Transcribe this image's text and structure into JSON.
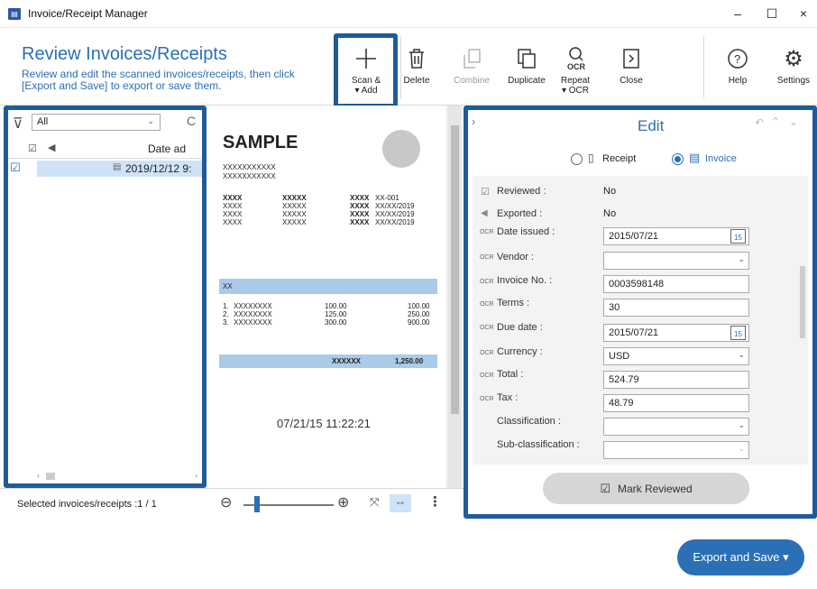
{
  "app": {
    "title": "Invoice/Receipt Manager"
  },
  "window": {
    "minimize": "–",
    "maximize": "☐",
    "close": "×"
  },
  "header": {
    "title": "Review Invoices/Receipts",
    "description": "Review and edit the scanned invoices/receipts, then click [Export and Save] to export or save them."
  },
  "toolbar": {
    "scan_add": "Scan & ▾ Add",
    "delete": "Delete",
    "combine": "Combine",
    "duplicate": "Duplicate",
    "repeat_ocr": "Repeat ▾ OCR",
    "close": "Close",
    "help": "Help",
    "settings": "Settings"
  },
  "list": {
    "filter_value": "All",
    "col_date": "Date ad",
    "rows": [
      {
        "date": "2019/12/12 9:"
      }
    ]
  },
  "status": {
    "selected": "Selected invoices/receipts :1 / 1"
  },
  "document": {
    "heading": "SAMPLE",
    "line1": "XXXXXXXXXXX",
    "line2": "XXXXXXXXXXX",
    "grid": [
      [
        "XXXX",
        "XXXXX",
        "XXXX",
        "XX-001"
      ],
      [
        "XXXX",
        "XXXXX",
        "XXXX",
        "XX/XX/2019"
      ],
      [
        "XXXX",
        "XXXXX",
        "XXXX",
        "XX/XX/2019"
      ],
      [
        "XXXX",
        "XXXXX",
        "XXXX",
        "XX/XX/2019"
      ]
    ],
    "band": "XX",
    "items": [
      [
        "1.",
        "XXXXXXXX",
        "100.00",
        "100.00"
      ],
      [
        "2.",
        "XXXXXXXX",
        "125.00",
        "250.00"
      ],
      [
        "3.",
        "XXXXXXXX",
        "300.00",
        "900.00"
      ]
    ],
    "total_label": "XXXXXX",
    "total_value": "1,250.00",
    "timestamp": "07/21/15  11:22:21"
  },
  "edit": {
    "title": "Edit",
    "type_receipt": "Receipt",
    "type_invoice": "Invoice",
    "fields": {
      "reviewed": {
        "label": "Reviewed :",
        "value": "No"
      },
      "exported": {
        "label": "Exported :",
        "value": "No"
      },
      "date_issued": {
        "label": "Date issued :",
        "value": "2015/07/21"
      },
      "vendor": {
        "label": "Vendor :",
        "value": ""
      },
      "invoice_no": {
        "label": "Invoice No. :",
        "value": "0003598148"
      },
      "terms": {
        "label": "Terms :",
        "value": "30"
      },
      "due_date": {
        "label": "Due date :",
        "value": "2015/07/21"
      },
      "currency": {
        "label": "Currency :",
        "value": "USD"
      },
      "total": {
        "label": "Total :",
        "value": "524.79"
      },
      "tax": {
        "label": "Tax :",
        "value": "48.79"
      },
      "classification": {
        "label": "Classification :",
        "value": ""
      },
      "sub_classification": {
        "label": "Sub-classification :",
        "value": ""
      }
    },
    "calendar_day": "15",
    "ocr_tag": "OCR",
    "mark_reviewed": "Mark Reviewed"
  },
  "export_button": "Export and Save  ▾",
  "colors": {
    "accent": "#2b6fb5",
    "highlight": "#1f5b99",
    "band": "#a9cbe8"
  }
}
